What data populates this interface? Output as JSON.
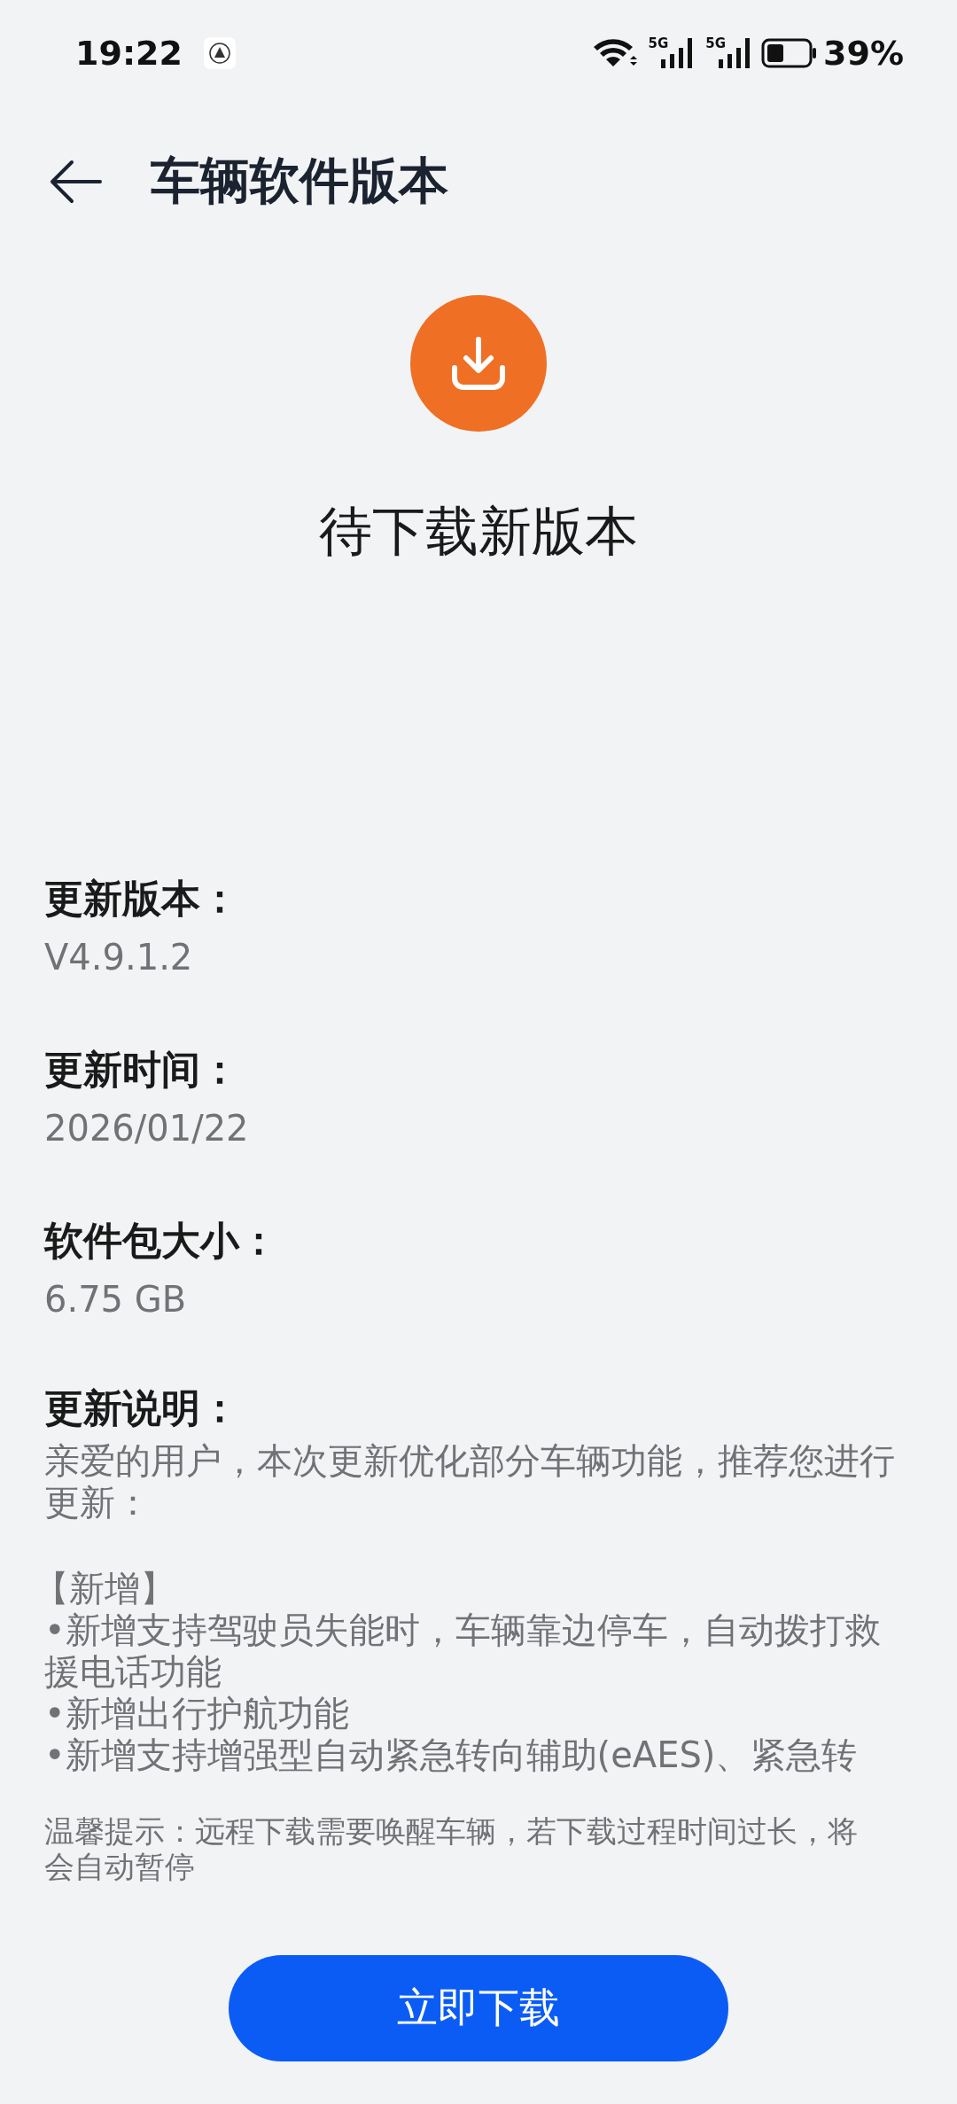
{
  "status_bar": {
    "time": "19:22",
    "networks": [
      "5G",
      "5G"
    ],
    "battery": "39%"
  },
  "header": {
    "title": "车辆软件版本"
  },
  "status_text": "待下载新版本",
  "info": [
    {
      "label": "更新版本：",
      "value": "V4.9.1.2"
    },
    {
      "label": "更新时间：",
      "value": "2026/01/22"
    },
    {
      "label": "软件包大小：",
      "value": "6.75 GB"
    }
  ],
  "notes": {
    "label": "更新说明：",
    "intro": "亲爱的用户，本次更新优化部分车辆功能，推荐您进行更新：",
    "heading": "【新增】",
    "items": [
      "•新增支持驾驶员失能时，车辆靠边停车，自动拨打救援电话功能",
      "•新增出行护航功能",
      "•新增支持增强型自动紧急转向辅助(eAES)、紧急转"
    ]
  },
  "tip": "温馨提示：远程下载需要唤醒车辆，若下载过程时间过长，将会自动暂停",
  "button": "立即下载"
}
